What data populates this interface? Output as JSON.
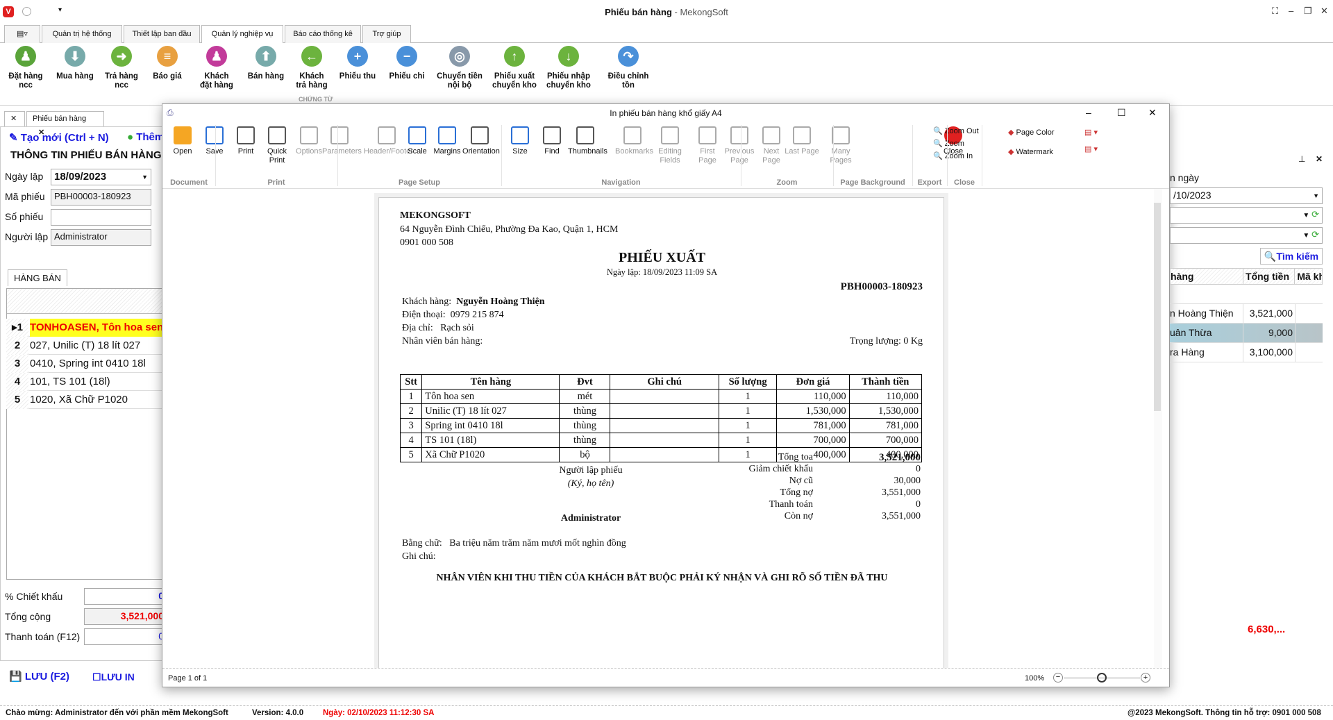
{
  "app": {
    "title": "Phiếu bán hàng",
    "brand": " - MekongSoft"
  },
  "ribbon_tabs": [
    "Quản trị hệ thống",
    "Thiết lập ban đầu",
    "Quản lý nghiệp vụ",
    "Báo cáo thống kê",
    "Trợ giúp"
  ],
  "ribbon_buttons": [
    {
      "l1": "Đặt hàng",
      "l2": "ncc",
      "color": "#5aa43a",
      "g": "♟"
    },
    {
      "l1": "Mua hàng",
      "l2": "",
      "color": "#7aa",
      "g": "⬇"
    },
    {
      "l1": "Trả hàng",
      "l2": "ncc",
      "color": "#6cb33e",
      "g": "➜"
    },
    {
      "l1": "Báo giá",
      "l2": "",
      "color": "#e8a040",
      "g": "≡"
    },
    {
      "l1": "Khách",
      "l2": "đặt hàng",
      "color": "#c23b9a",
      "g": "♟"
    },
    {
      "l1": "Bán hàng",
      "l2": "",
      "color": "#7aa",
      "g": "⬆"
    },
    {
      "l1": "Khách",
      "l2": "trả hàng",
      "color": "#6cb33e",
      "g": "←"
    },
    {
      "l1": "Phiếu thu",
      "l2": "",
      "color": "#4a90d9",
      "g": "+"
    },
    {
      "l1": "Phiếu chi",
      "l2": "",
      "color": "#4a90d9",
      "g": "−"
    },
    {
      "l1": "Chuyển tiền",
      "l2": "nội bộ",
      "color": "#8899aa",
      "g": "◎"
    },
    {
      "l1": "Phiếu xuất",
      "l2": "chuyển kho",
      "color": "#6cb33e",
      "g": "↑"
    },
    {
      "l1": "Phiếu nhập",
      "l2": "chuyển kho",
      "color": "#6cb33e",
      "g": "↓"
    },
    {
      "l1": "Điều chỉnh tồn",
      "l2": "",
      "color": "#4a90d9",
      "g": "↷"
    }
  ],
  "ribbon_group": "CHỨNG TỪ",
  "doc_tab": "Phiếu bán hàng",
  "left": {
    "new_btn": "Tạo mới (Ctrl + N)",
    "add_btn": "Thêm",
    "section": "THÔNG TIN PHIẾU BÁN HÀNG",
    "date_label": "Ngày lập",
    "date": "18/09/2023",
    "code_label": "Mã phiếu",
    "code": "PBH00003-180923",
    "num_label": "Số phiếu",
    "num": "",
    "creator_label": "Người lập",
    "creator": "Administrator",
    "goods_tab": "HÀNG BÁN",
    "rows": [
      "TONHOASEN, Tôn hoa sen",
      "027, Unilic (T) 18 lít 027",
      "0410, Spring int 0410 18l",
      "101, TS 101 (18l)",
      "1020, Xã Chữ P1020"
    ],
    "discount_label": "% Chiết khấu",
    "discount": "0",
    "total_label": "Tổng cộng",
    "total": "3,521,000",
    "pay_label": "Thanh toán (F12)",
    "pay": "0",
    "save_btn": "LƯU (F2)",
    "save_print": "LƯU IN"
  },
  "dialog": {
    "title": "In phiếu bán hàng khổ giấy A4",
    "buttons": [
      {
        "label": "Open",
        "x": 0
      },
      {
        "label": "Save",
        "x": 0
      },
      {
        "label": "Print"
      },
      {
        "label": "Quick Print"
      },
      {
        "label": "Options"
      },
      {
        "label": "Parameters"
      },
      {
        "label": "Header/Footer"
      },
      {
        "label": "Scale"
      },
      {
        "label": "Margins"
      },
      {
        "label": "Orientation"
      },
      {
        "label": "Size"
      },
      {
        "label": "Find"
      },
      {
        "label": "Thumbnails"
      },
      {
        "label": "Bookmarks"
      },
      {
        "label": "Editing Fields"
      },
      {
        "label": "First Page"
      },
      {
        "label": "Previous Page"
      },
      {
        "label": "Next Page"
      },
      {
        "label": "Last Page"
      },
      {
        "label": "Many Pages"
      },
      {
        "label": "Close"
      }
    ],
    "zoom_items": [
      "Zoom Out",
      "Zoom",
      "Zoom In"
    ],
    "bg_items": [
      "Page Color",
      "Watermark"
    ],
    "groups": [
      "Document",
      "Print",
      "Page Setup",
      "Navigation",
      "Zoom",
      "Page Background",
      "Export",
      "Close"
    ],
    "page_status": "Page 1 of 1",
    "zoom_level": "100%"
  },
  "invoice": {
    "company": "MEKONGSOFT",
    "address": "64 Nguyễn Đình Chiểu, Phường Đa Kao, Quận 1, HCM",
    "phone": "0901 000 508",
    "title": "PHIẾU XUẤT",
    "date": "Ngày lập: 18/09/2023  11:09 SA",
    "code": "PBH00003-180923",
    "customer_label": "Khách hàng:",
    "customer": "Nguyễn Hoàng Thiện",
    "tel_label": "Điện thoại:",
    "tel": "0979 215 874",
    "addr_label": "Địa chỉ:",
    "addr": "Rạch sỏi",
    "staff_label": "Nhân viên bán hàng:",
    "weight": "Trọng lượng: 0 Kg",
    "headers": [
      "Stt",
      "Tên hàng",
      "Đvt",
      "Ghi chú",
      "Số lượng",
      "Đơn giá",
      "Thành tiền"
    ],
    "rows": [
      [
        "1",
        "Tôn hoa sen",
        "mét",
        "",
        "1",
        "110,000",
        "110,000"
      ],
      [
        "2",
        "Unilic (T) 18 lít 027",
        "thùng",
        "",
        "1",
        "1,530,000",
        "1,530,000"
      ],
      [
        "3",
        "Spring int 0410 18l",
        "thùng",
        "",
        "1",
        "781,000",
        "781,000"
      ],
      [
        "4",
        "TS 101 (18l)",
        "thùng",
        "",
        "1",
        "700,000",
        "700,000"
      ],
      [
        "5",
        "Xã Chữ P1020",
        "bộ",
        "",
        "1",
        "400,000",
        "400,000"
      ]
    ],
    "totals": [
      [
        "Tổng toa",
        "3,521,000"
      ],
      [
        "Giảm chiết khấu",
        "0"
      ],
      [
        "Nợ cũ",
        "30,000"
      ],
      [
        "Tổng nợ",
        "3,551,000"
      ],
      [
        "Thanh toán",
        "0"
      ],
      [
        "Còn nợ",
        "3,551,000"
      ]
    ],
    "signer_title": "Người lập phiếu",
    "signer_note": "(Ký, họ tên)",
    "signer": "Administrator",
    "words_label": "Bằng chữ:",
    "words": "Ba triệu năm trăm năm mươi mốt nghìn đồng",
    "note_label": "Ghi chú:",
    "notice": "NHÂN VIÊN KHI THU TIỀN CỦA KHÁCH BẮT BUỘC PHẢI KÝ NHẬN VÀ GHI RÕ SỐ TIỀN ĐÃ THU"
  },
  "right": {
    "date_label": "n ngày",
    "date": "/10/2023",
    "search": "Tìm kiếm",
    "headers": [
      "hàng",
      "Tổng tiền",
      "Mã kh"
    ],
    "rows": [
      [
        "n Hoàng Thiện",
        "3,521,000"
      ],
      [
        "uân Thừa",
        "9,000"
      ],
      [
        "ra Hàng",
        "3,100,000"
      ]
    ],
    "sum": "6,630,..."
  },
  "status": {
    "welcome": "Chào mừng: Administrator đến với phần mềm MekongSoft",
    "version": "Version: 4.0.0",
    "date": "Ngày: 02/10/2023 11:12:30 SA",
    "copyright": "@2023 MekongSoft. Thông tin hỗ trợ: 0901 000 508"
  }
}
